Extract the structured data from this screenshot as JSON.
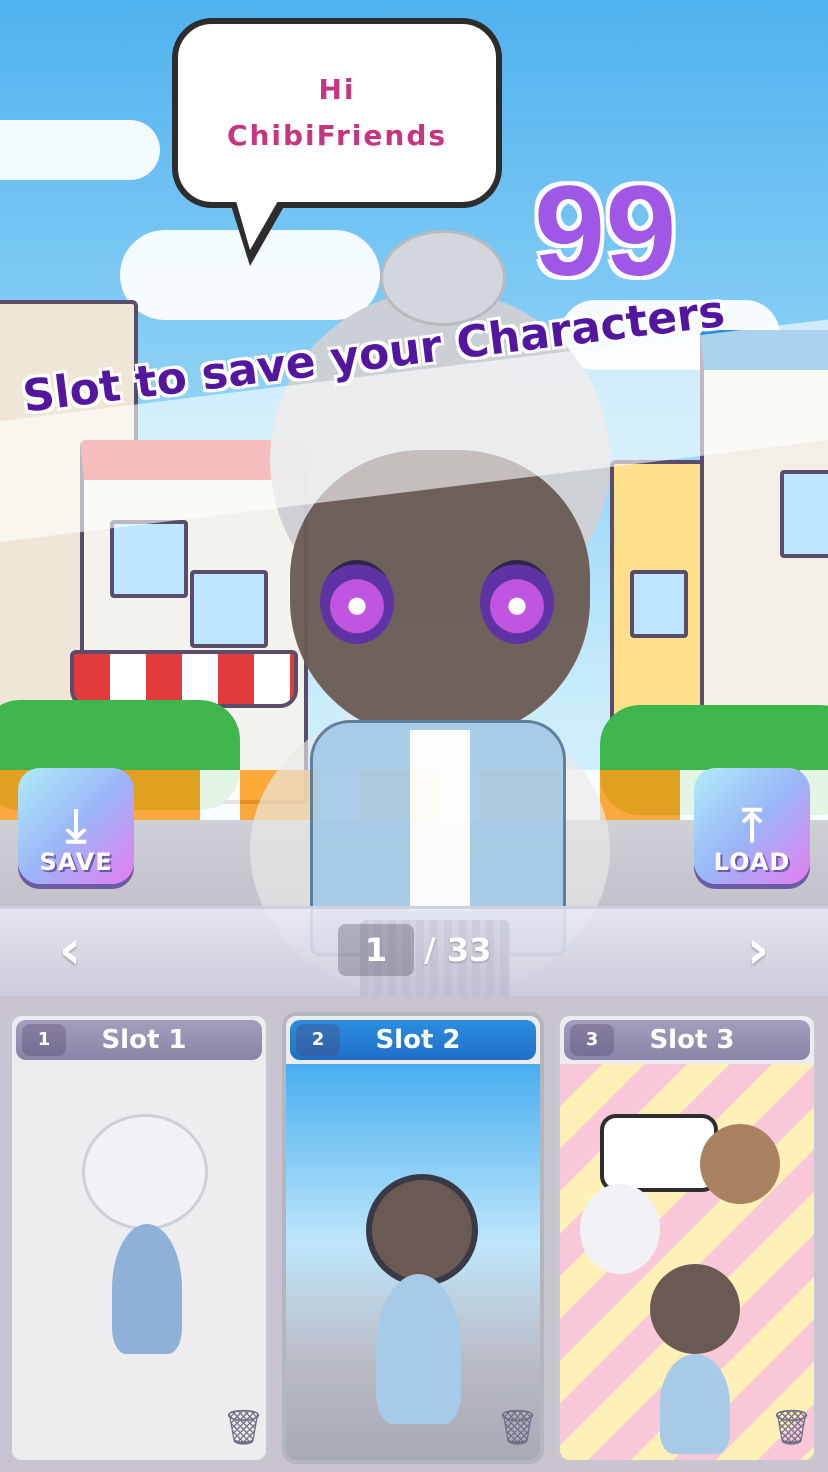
{
  "bubble": {
    "line1": "Hi",
    "line2": "ChibiFriends"
  },
  "promo": {
    "number": "99",
    "headline": "Slot to save your Characters"
  },
  "buttons": {
    "save_label": "SAVE",
    "load_label": "LOAD",
    "save_icon": "download-icon",
    "load_icon": "upload-icon"
  },
  "pager": {
    "prev_icon": "chevron-left-icon",
    "next_icon": "chevron-right-icon",
    "current": "1",
    "total": "/ 33"
  },
  "slots": [
    {
      "number": "1",
      "title": "Slot 1",
      "background": "plain-gray"
    },
    {
      "number": "2",
      "title": "Slot 2",
      "background": "town-street"
    },
    {
      "number": "3",
      "title": "Slot 3",
      "background": "pink-yellow-stripes"
    }
  ],
  "colors": {
    "accent_purple": "#a057e6",
    "headline_purple": "#52179e",
    "bubble_text": "#c7357e",
    "slot_selected": "#1f6fc7"
  }
}
